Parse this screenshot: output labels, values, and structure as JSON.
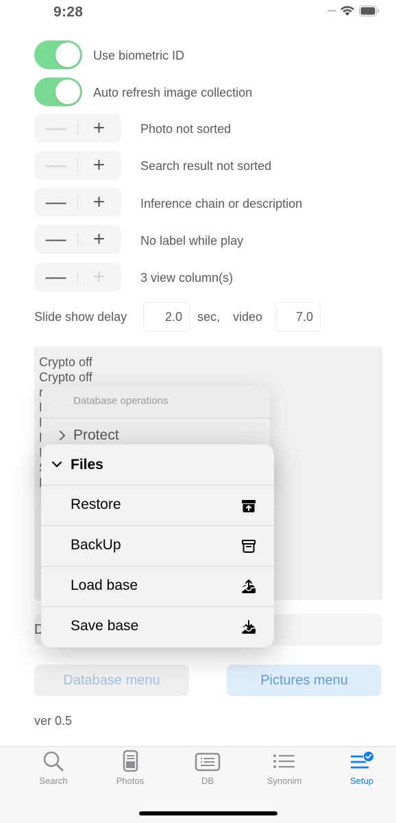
{
  "status_bar": {
    "time": "9:28"
  },
  "settings": {
    "toggles": [
      {
        "label": "Use biometric ID",
        "on": true
      },
      {
        "label": "Auto refresh image collection",
        "on": true
      }
    ],
    "steppers": [
      {
        "label": "Photo not sorted"
      },
      {
        "label": "Search result not sorted"
      },
      {
        "label": "Inference chain or description"
      },
      {
        "label": "No label while play"
      },
      {
        "label": "3 view column(s)"
      }
    ],
    "stepper_minus": "—",
    "stepper_plus": "+",
    "slideshow": {
      "label": "Slide show delay",
      "delay_value": "2.0",
      "sec_label": "sec,",
      "video_label": "video",
      "video_value": "7.0"
    }
  },
  "log": {
    "lines": [
      "Crypto off",
      "Crypto off",
      "r",
      "R",
      "R",
      "R",
      "I",
      "S",
      "I"
    ]
  },
  "database_menu": {
    "header": "Database operations",
    "protect": "Protect",
    "files_header": "Files",
    "items": [
      {
        "label": "Restore",
        "icon": "archive-restore-icon"
      },
      {
        "label": "BackUp",
        "icon": "archive-box-icon"
      },
      {
        "label": "Load base",
        "icon": "tray-upload-icon"
      },
      {
        "label": "Save base",
        "icon": "tray-download-icon"
      }
    ],
    "field_partial": "D"
  },
  "buttons": {
    "database_menu": "Database menu",
    "pictures_menu": "Pictures menu"
  },
  "version": "ver 0.5",
  "tabs": [
    {
      "label": "Search",
      "icon": "magnifier-icon"
    },
    {
      "label": "Photos",
      "icon": "photo-doc-icon"
    },
    {
      "label": "DB",
      "icon": "db-list-icon"
    },
    {
      "label": "Synonim",
      "icon": "list-bullet-icon"
    },
    {
      "label": "Setup",
      "icon": "setup-check-icon",
      "selected": true
    }
  ],
  "colors": {
    "toggle_on": "#34c759",
    "accent": "#0a7aff",
    "pictures_button_bg": "#cfe3fa",
    "database_button_bg": "#e6e6e8"
  }
}
